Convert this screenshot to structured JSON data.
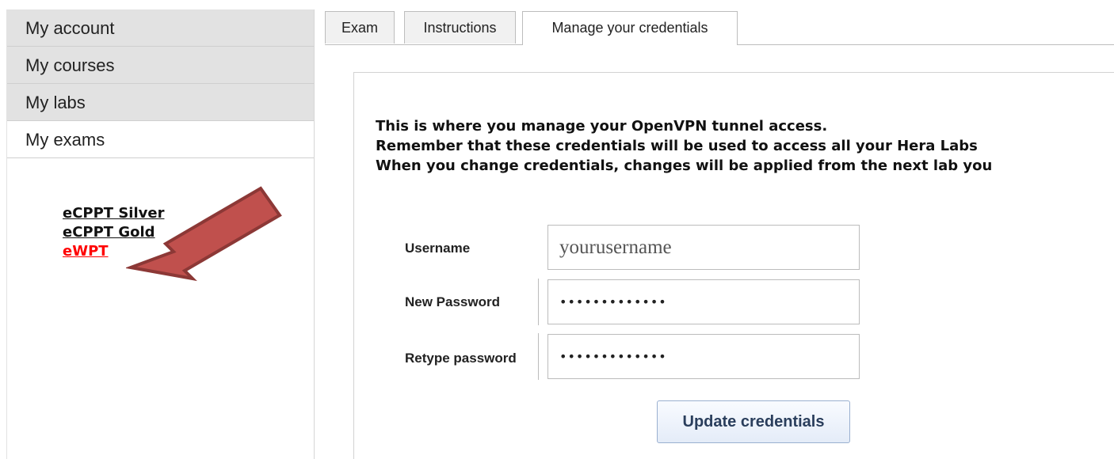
{
  "sidebar": {
    "items": [
      {
        "label": "My account"
      },
      {
        "label": "My courses"
      },
      {
        "label": "My labs"
      },
      {
        "label": "My exams"
      }
    ],
    "exams": [
      {
        "label": "eCPPT Silver"
      },
      {
        "label": "eCPPT Gold"
      },
      {
        "label": "eWPT"
      }
    ]
  },
  "tabs": [
    {
      "label": "Exam"
    },
    {
      "label": "Instructions"
    },
    {
      "label": "Manage your credentials"
    }
  ],
  "content": {
    "intro_lines": [
      "This is where you manage your OpenVPN tunnel access.",
      "Remember that these credentials will be used to access all your Hera Labs",
      "When you change credentials, changes will be applied from the next lab you"
    ],
    "form": {
      "username_label": "Username",
      "username_value": "yourusername",
      "new_password_label": "New Password",
      "new_password_value": "•••••••••••••",
      "retype_password_label": "Retype password",
      "retype_password_value": "•••••••••••••",
      "submit_label": "Update credentials"
    }
  },
  "colors": {
    "sidebar_bg": "#e2e2e2",
    "active_link": "#ff0000",
    "arrow_fill": "#c0504d",
    "arrow_stroke": "#8c3836"
  }
}
